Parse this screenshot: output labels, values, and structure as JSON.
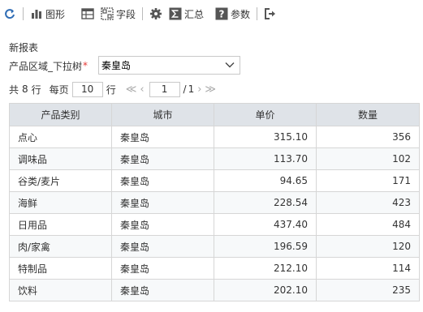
{
  "toolbar": {
    "refresh_icon": "refresh-icon",
    "chart_label": "图形",
    "field_label": "字段",
    "summary_label": "汇总",
    "param_label": "参数",
    "colors": {
      "accent": "#2f6db5",
      "icon": "#555555"
    }
  },
  "report": {
    "title": "新报表",
    "param": {
      "label": "产品区域_下拉树",
      "required_mark": "*",
      "value": "秦皇岛"
    },
    "pager": {
      "total_prefix": "共",
      "total": "8",
      "total_suffix": "行",
      "per_page_prefix": "每页",
      "per_page": "10",
      "per_page_suffix": "行",
      "current_page": "1",
      "page_sep": "/",
      "total_pages": "1"
    },
    "table": {
      "headers": [
        "产品类别",
        "城市",
        "单价",
        "数量"
      ],
      "rows": [
        [
          "点心",
          "秦皇岛",
          "315.10",
          "356"
        ],
        [
          "调味品",
          "秦皇岛",
          "113.70",
          "102"
        ],
        [
          "谷类/麦片",
          "秦皇岛",
          "94.65",
          "171"
        ],
        [
          "海鲜",
          "秦皇岛",
          "228.54",
          "423"
        ],
        [
          "日用品",
          "秦皇岛",
          "437.40",
          "484"
        ],
        [
          "肉/家禽",
          "秦皇岛",
          "196.59",
          "120"
        ],
        [
          "特制品",
          "秦皇岛",
          "212.10",
          "114"
        ],
        [
          "饮料",
          "秦皇岛",
          "202.10",
          "235"
        ]
      ]
    }
  }
}
